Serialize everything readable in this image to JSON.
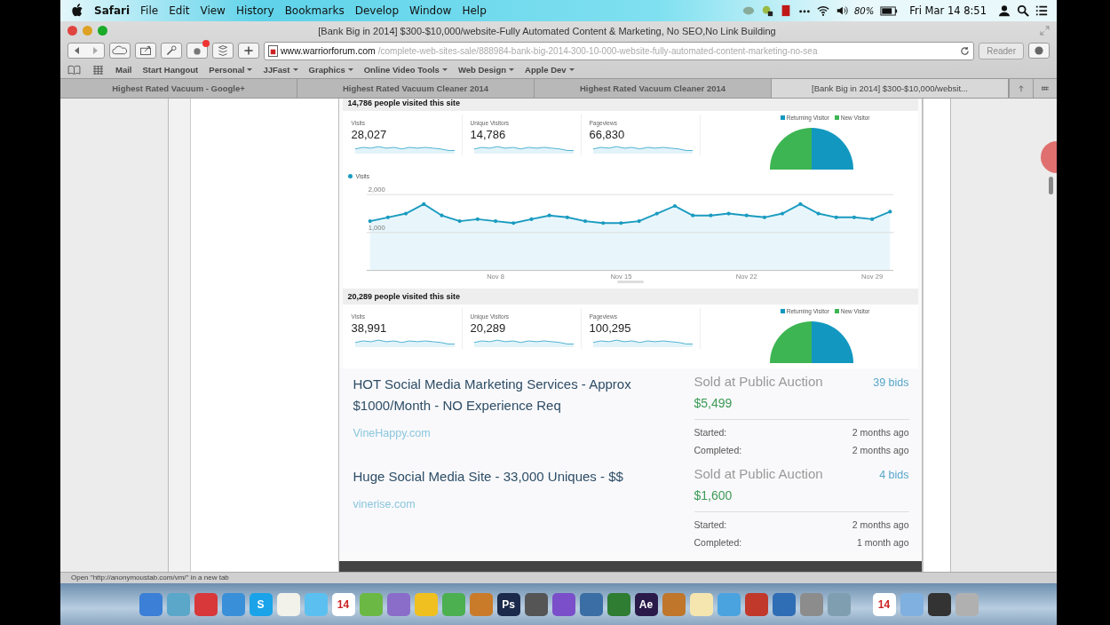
{
  "menu_bar": {
    "app": "Safari",
    "items": [
      "File",
      "Edit",
      "View",
      "History",
      "Bookmarks",
      "Develop",
      "Window",
      "Help"
    ],
    "battery": "80%",
    "clock": "Fri Mar 14  8:51"
  },
  "window": {
    "title": "[Bank Big in 2014] $300-$10,000/website-Fully Automated Content & Marketing, No SEO,No Link Building"
  },
  "address_bar": {
    "domain": "www.warriorforum.com",
    "path": "/complete-web-sites-sale/888984-bank-big-2014-300-10-000-website-fully-automated-content-marketing-no-sea"
  },
  "reader_button": {
    "label": "Reader",
    "disabled": true
  },
  "bookmarks": [
    {
      "label": "Mail",
      "menu": false
    },
    {
      "label": "Start Hangout",
      "menu": false
    },
    {
      "label": "Personal",
      "menu": true
    },
    {
      "label": "JJFast",
      "menu": true
    },
    {
      "label": "Graphics",
      "menu": true
    },
    {
      "label": "Online Video Tools",
      "menu": true
    },
    {
      "label": "Web Design",
      "menu": true
    },
    {
      "label": "Apple Dev",
      "menu": true
    }
  ],
  "tabs": [
    {
      "label": "Highest Rated Vacuum - Google+",
      "selected": false
    },
    {
      "label": "Highest Rated Vacuum Cleaner 2014",
      "selected": false
    },
    {
      "label": "Highest Rated Vacuum Cleaner 2014",
      "selected": false
    },
    {
      "label": "[Bank Big in 2014] $300-$10,000/websit...",
      "selected": true
    }
  ],
  "stats_panels": [
    {
      "heading": "14,786 people visited this site",
      "metrics": [
        {
          "label": "Visits",
          "value": "28,027"
        },
        {
          "label": "Unique Visitors",
          "value": "14,786"
        },
        {
          "label": "Pageviews",
          "value": "66,830"
        }
      ],
      "legend": [
        {
          "label": "Returning Visitor",
          "color": "#1298c0"
        },
        {
          "label": "New Visitor",
          "color": "#3db552"
        }
      ],
      "chart_data": {
        "type": "area",
        "categories": [
          null,
          null,
          null,
          null,
          null,
          null,
          null,
          "Nov 8",
          null,
          null,
          null,
          null,
          null,
          null,
          "Nov 15",
          null,
          null,
          null,
          null,
          null,
          null,
          "Nov 22",
          null,
          null,
          null,
          null,
          null,
          null,
          "Nov 29",
          null
        ],
        "series": [
          {
            "name": "Visits",
            "color": "#1a9bc0",
            "values": [
              1300,
              1400,
              1500,
              1750,
              1450,
              1300,
              1350,
              1300,
              1250,
              1350,
              1450,
              1400,
              1300,
              1250,
              1250,
              1300,
              1500,
              1700,
              1450,
              1450,
              1500,
              1450,
              1400,
              1500,
              1750,
              1500,
              1400,
              1400,
              1350,
              1550
            ]
          }
        ],
        "ylim": [
          0,
          2000
        ],
        "yticks": [
          {
            "value": 1000,
            "label": "1,000"
          },
          {
            "value": 2000,
            "label": "2,000"
          }
        ]
      }
    },
    {
      "heading": "20,289 people visited this site",
      "metrics": [
        {
          "label": "Visits",
          "value": "38,991"
        },
        {
          "label": "Unique Visitors",
          "value": "20,289"
        },
        {
          "label": "Pageviews",
          "value": "100,295"
        }
      ],
      "legend": [
        {
          "label": "Returning Visitor",
          "color": "#1298c0"
        },
        {
          "label": "New Visitor",
          "color": "#3db552"
        }
      ]
    }
  ],
  "listings": [
    {
      "title": "HOT Social Media Marketing Services - Approx $1000/Month - NO Experience Req",
      "domain": "VineHappy.com",
      "sale_type": "Sold at Public Auction",
      "bids": "39 bids",
      "price": "$5,499",
      "started_label": "Started:",
      "started": "2 months ago",
      "completed_label": "Completed:",
      "completed": "2 months ago"
    },
    {
      "title": "Huge Social Media Site - 33,000 Uniques - $$",
      "domain": "vinerise.com",
      "sale_type": "Sold at Public Auction",
      "bids": "4 bids",
      "price": "$1,600",
      "started_label": "Started:",
      "started": "2 months ago",
      "completed_label": "Completed:",
      "completed": "1 month ago"
    }
  ],
  "status_bar": "Open \"http://anonymoustab.com/vm/\" in a new tab",
  "dock": [
    {
      "color": "#3b7fd6"
    },
    {
      "color": "#5aa7c9"
    },
    {
      "color": "#d8383a"
    },
    {
      "color": "#3a8fd9"
    },
    {
      "color": "#1aa3e8",
      "label": "S"
    },
    {
      "color": "#f2f2ea"
    },
    {
      "color": "#5bc0f0"
    },
    {
      "color": "#ffffff",
      "label": "14"
    },
    {
      "color": "#6bb844"
    },
    {
      "color": "#8a6cc9"
    },
    {
      "color": "#f0c020"
    },
    {
      "color": "#4caf50"
    },
    {
      "color": "#c97b2a"
    },
    {
      "color": "#1b2a4a",
      "label": "Ps"
    },
    {
      "color": "#555555"
    },
    {
      "color": "#7b4fc9"
    },
    {
      "color": "#3a6ea5"
    },
    {
      "color": "#2e7d32"
    },
    {
      "color": "#2a1a4a",
      "label": "Ae"
    },
    {
      "color": "#c0762b"
    },
    {
      "color": "#f5e6b0"
    },
    {
      "color": "#4aa3df"
    },
    {
      "color": "#c0392b"
    },
    {
      "color": "#2f6db5"
    },
    {
      "color": "#8c8c8c"
    },
    {
      "color": "#7f9fb0"
    },
    {
      "color": "#ffffff",
      "label": "14"
    },
    {
      "color": "#7fb0e0"
    },
    {
      "color": "#333333"
    },
    {
      "color": "#b0b0b0"
    }
  ]
}
